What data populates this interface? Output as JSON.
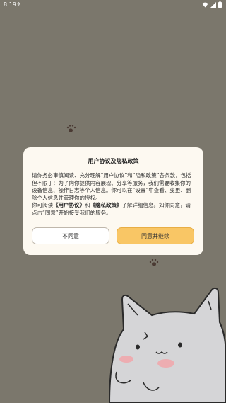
{
  "status_bar": {
    "time": "8:19",
    "extra": "✈"
  },
  "dialog": {
    "title": "用户协议及隐私政策",
    "paragraph1": "请你务必审慎阅读、充分理解“用户协议”和“隐私政策”各条款，包括但不限于：为了向你提供内容展现、分享等服务，我们需要收集你的设备信息、操作日志等个人信息。你可以在“设置”中查看、变更、删除个人信息并管理你的授权。",
    "p2_prefix": "你可阅读",
    "link_user_agreement": "《用户协议》",
    "p2_and": "和",
    "link_privacy_policy": "《隐私政策》",
    "p2_suffix": "了解详细信息。如你同意，请点击“同意”开始接受我们的服务。",
    "disagree_label": "不同意",
    "agree_label": "同意并继续"
  },
  "colors": {
    "background": "#7b776c",
    "dialog": "#fdf9f1",
    "agree_button": "#f9c665"
  }
}
